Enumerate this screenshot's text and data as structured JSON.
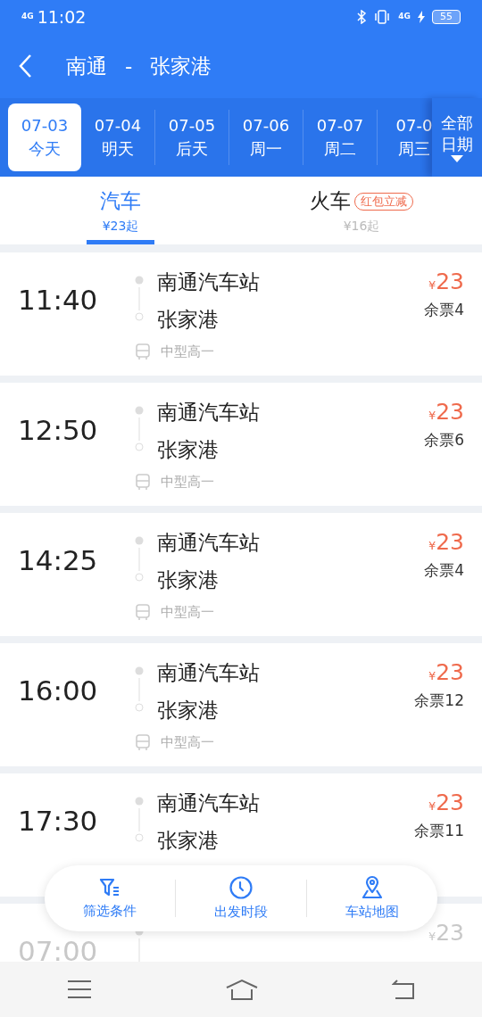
{
  "status_bar": {
    "network": "4G",
    "time": "11:02",
    "network_right": "4G",
    "battery": "55"
  },
  "header": {
    "from": "南通",
    "separator": "-",
    "to": "张家港"
  },
  "dates": [
    {
      "date": "07-03",
      "day": "今天",
      "selected": true
    },
    {
      "date": "07-04",
      "day": "明天",
      "selected": false
    },
    {
      "date": "07-05",
      "day": "后天",
      "selected": false
    },
    {
      "date": "07-06",
      "day": "周一",
      "selected": false
    },
    {
      "date": "07-07",
      "day": "周二",
      "selected": false
    },
    {
      "date": "07-0",
      "day": "周三",
      "selected": false
    }
  ],
  "all_dates": {
    "line1": "全部",
    "line2": "日期"
  },
  "transport_tabs": [
    {
      "label": "汽车",
      "price": "¥23起",
      "selected": true
    },
    {
      "label": "火车",
      "price": "¥16起",
      "badge": "红包立减",
      "selected": false
    }
  ],
  "trips": [
    {
      "time": "11:40",
      "from": "南通汽车站",
      "to": "张家港",
      "bus_type": "中型高一",
      "currency": "¥",
      "price": "23",
      "tickets": "余票4",
      "disabled": false
    },
    {
      "time": "12:50",
      "from": "南通汽车站",
      "to": "张家港",
      "bus_type": "中型高一",
      "currency": "¥",
      "price": "23",
      "tickets": "余票6",
      "disabled": false
    },
    {
      "time": "14:25",
      "from": "南通汽车站",
      "to": "张家港",
      "bus_type": "中型高一",
      "currency": "¥",
      "price": "23",
      "tickets": "余票4",
      "disabled": false
    },
    {
      "time": "16:00",
      "from": "南通汽车站",
      "to": "张家港",
      "bus_type": "中型高一",
      "currency": "¥",
      "price": "23",
      "tickets": "余票12",
      "disabled": false
    },
    {
      "time": "17:30",
      "from": "南通汽车站",
      "to": "张家港",
      "currency": "¥",
      "price": "23",
      "tickets": "余票11",
      "disabled": false
    },
    {
      "time": "07:00",
      "currency": "¥",
      "price": "23",
      "disabled": true
    }
  ],
  "bottom_actions": [
    {
      "kind": "filter",
      "label": "筛选条件"
    },
    {
      "kind": "clock",
      "label": "出发时段"
    },
    {
      "kind": "map",
      "label": "车站地图"
    }
  ]
}
